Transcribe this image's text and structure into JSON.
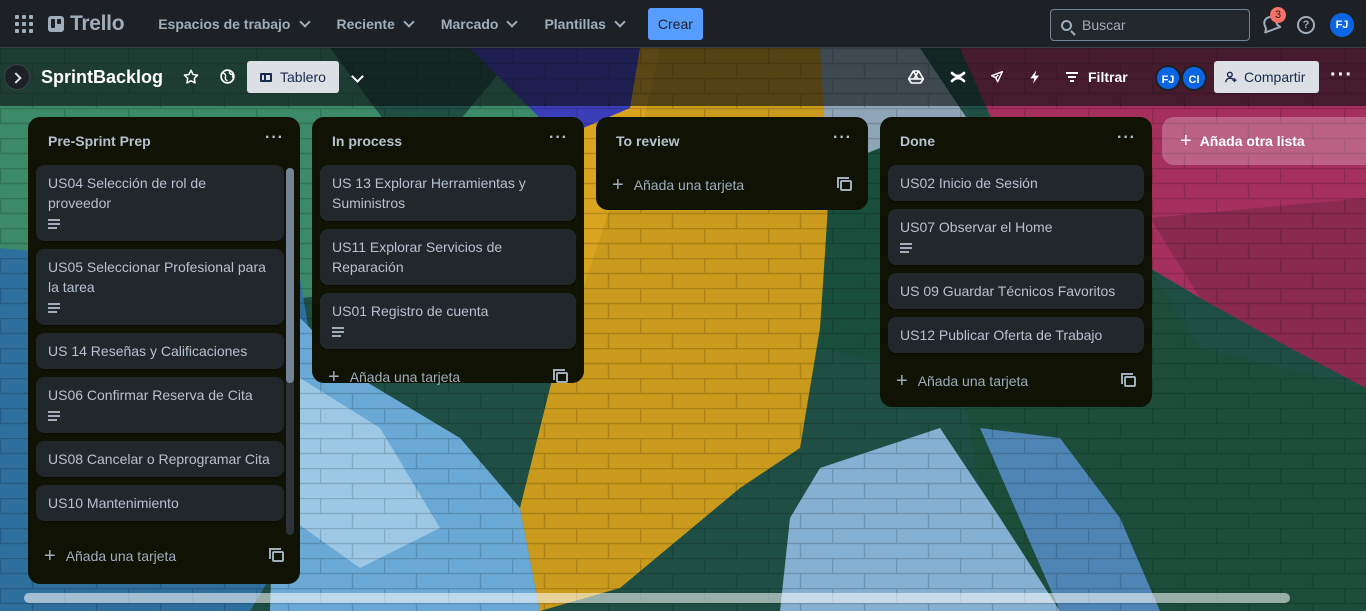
{
  "header": {
    "logo": "Trello",
    "nav": [
      "Espacios de trabajo",
      "Reciente",
      "Marcado",
      "Plantillas"
    ],
    "create_label": "Crear",
    "search_placeholder": "Buscar",
    "notification_count": "3",
    "user_initials": "FJ"
  },
  "board": {
    "title": "SprintBacklog",
    "view_label": "Tablero",
    "filter_label": "Filtrar",
    "members": [
      "FJ",
      "CI"
    ],
    "share_label": "Compartir",
    "add_list_label": "Añada otra lista"
  },
  "lists": [
    {
      "title": "Pre-Sprint Prep",
      "add_card_label": "Añada una tarjeta",
      "cards": [
        {
          "title": "US04 Selección de rol de proveedor",
          "has_description": true
        },
        {
          "title": "US05 Seleccionar Profesional para la tarea",
          "has_description": true
        },
        {
          "title": "US 14 Reseñas y Calificaciones",
          "has_description": false
        },
        {
          "title": "US06 Confirmar Reserva de Cita",
          "has_description": true
        },
        {
          "title": "US08 Cancelar o Reprogramar Cita",
          "has_description": false
        },
        {
          "title": "US10 Mantenimiento",
          "has_description": false
        }
      ]
    },
    {
      "title": "In process",
      "add_card_label": "Añada una tarjeta",
      "cards": [
        {
          "title": "US 13 Explorar Herramientas y Suministros",
          "has_description": false
        },
        {
          "title": "US11 Explorar Servicios de Reparación",
          "has_description": false
        },
        {
          "title": "US01 Registro de cuenta",
          "has_description": true
        }
      ]
    },
    {
      "title": "To review",
      "add_card_label": "Añada una tarjeta",
      "cards": []
    },
    {
      "title": "Done",
      "add_card_label": "Añada una tarjeta",
      "cards": [
        {
          "title": "US02 Inicio de Sesión",
          "has_description": false
        },
        {
          "title": "US07 Observar el Home",
          "has_description": true
        },
        {
          "title": "US 09 Guardar Técnicos Favoritos",
          "has_description": false
        },
        {
          "title": "US12 Publicar Oferta de Trabajo",
          "has_description": false
        }
      ]
    }
  ],
  "colors": {
    "header_bg": "#1d2125",
    "list_bg": "#101204",
    "card_bg": "#22272b",
    "accent": "#579dff",
    "mural_blue": "#4a86c7",
    "mural_yellow": "#c99a1c",
    "mural_red": "#a5305e",
    "mural_green": "#1f5a3e"
  }
}
